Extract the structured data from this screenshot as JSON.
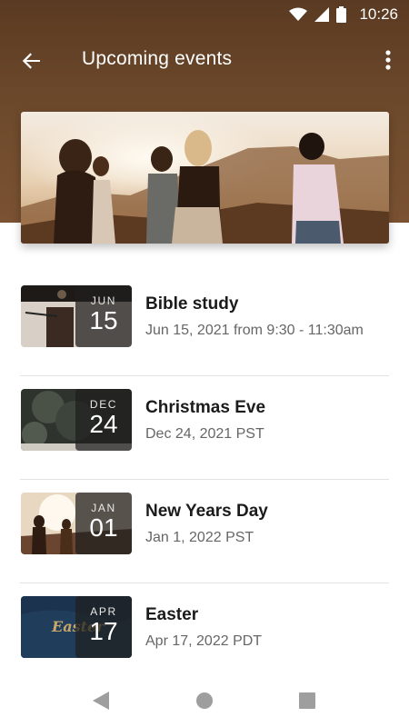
{
  "status_bar": {
    "time": "10:26",
    "icons": [
      "wifi-icon",
      "signal-icon",
      "battery-icon"
    ]
  },
  "app_bar": {
    "title": "Upcoming events",
    "back_icon": "arrow-back-icon",
    "menu_icon": "more-vert-icon"
  },
  "colors": {
    "header": "#6e4a2c",
    "title_text": "#1b1b1b",
    "subtitle_text": "#666666",
    "divider": "#e2e2e2"
  },
  "events": [
    {
      "month": "JUN",
      "day": "15",
      "title": "Bible study",
      "subtitle": "Jun 15, 2021 from 9:30 - 11:30am"
    },
    {
      "month": "DEC",
      "day": "24",
      "title": "Christmas Eve",
      "subtitle": "Dec 24, 2021 PST"
    },
    {
      "month": "JAN",
      "day": "01",
      "title": "New Years Day",
      "subtitle": "Jan 1, 2022 PST"
    },
    {
      "month": "APR",
      "day": "17",
      "title": "Easter",
      "subtitle": "Apr 17, 2022 PDT",
      "thumb_text": "Easter"
    }
  ],
  "nav_bar": {
    "icons": [
      "back-triangle-icon",
      "home-circle-icon",
      "recents-square-icon"
    ]
  }
}
